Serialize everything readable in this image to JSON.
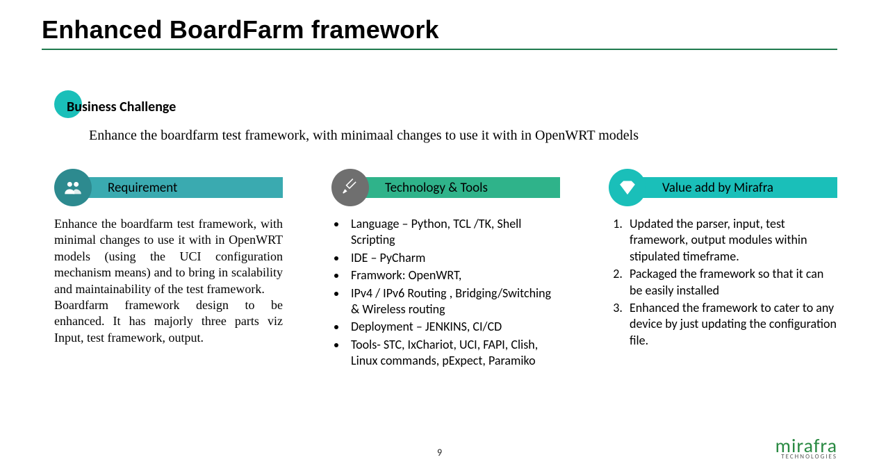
{
  "title": "Enhanced BoardFarm framework",
  "business": {
    "heading": "Business Challenge",
    "text": "Enhance the boardfarm test framework, with minimaal changes to use it with in OpenWRT models"
  },
  "requirement": {
    "heading": "Requirement",
    "para1": "Enhance the boardfarm test framework, with minimal changes to use it with in OpenWRT models (using the UCI configuration mechanism means) and to bring in scalability and maintainability of the test framework.",
    "para2": "Boardfarm framework design to be enhanced. It has majorly three parts viz Input, test framework, output."
  },
  "technology": {
    "heading": "Technology & Tools",
    "items": [
      "Language – Python, TCL /TK, Shell Scripting",
      "IDE – PyCharm",
      "Framwork:  OpenWRT,",
      "IPv4 / IPv6 Routing , Bridging/Switching & Wireless routing",
      "Deployment – JENKINS, CI/CD",
      "Tools- STC, IxChariot, UCI, FAPI, Clish, Linux commands, pExpect, Paramiko"
    ]
  },
  "value_add": {
    "heading": "Value add by Mirafra",
    "items": [
      "Updated the parser, input, test framework, output modules within stipulated timeframe.",
      "Packaged the framework so that it can be easily installed",
      "Enhanced the framework to cater to any device by just updating the configuration file."
    ]
  },
  "page_number": "9",
  "footer": {
    "brand": "mirafra",
    "sub": "TECHNOLOGIES"
  }
}
